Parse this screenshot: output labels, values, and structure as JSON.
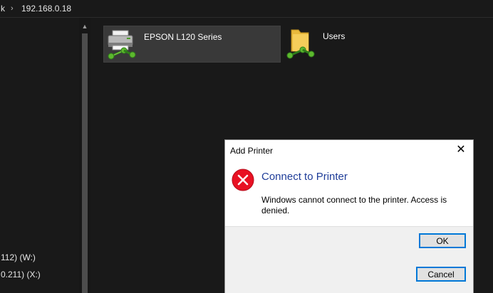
{
  "address_bar": {
    "prev_segment": "k",
    "current_segment": "192.168.0.18"
  },
  "nav_pane": {
    "items": [
      {
        "label": "112) (W:)"
      },
      {
        "label": "0.211) (X:)"
      }
    ]
  },
  "content": {
    "items": [
      {
        "label": "EPSON L120 Series",
        "type": "printer",
        "selected": true
      },
      {
        "label": "Users",
        "type": "shared-folder",
        "selected": false
      }
    ]
  },
  "dialog": {
    "title": "Add Printer",
    "close_symbol": "✕",
    "icon": "error-icon",
    "heading": "Connect to Printer",
    "message": "Windows cannot connect to the printer.  Access is denied.",
    "ok_label": "OK"
  },
  "wizard": {
    "cancel_label": "Cancel"
  },
  "colors": {
    "background": "#191919",
    "selection": "#393939",
    "heading_blue": "#1f3d99",
    "error_red": "#e81123",
    "focus_blue": "#0078d7"
  }
}
